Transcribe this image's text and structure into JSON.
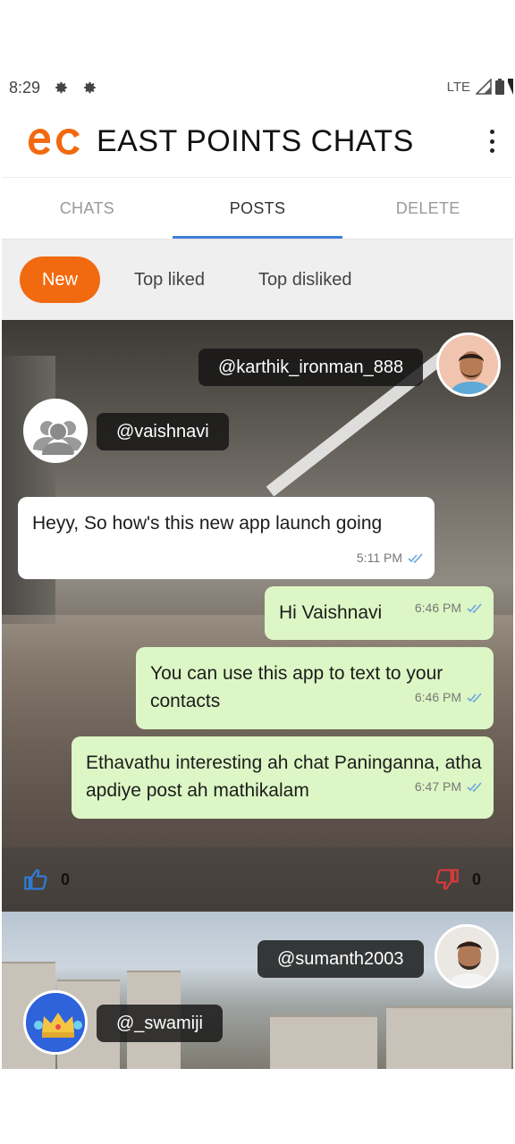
{
  "status_bar": {
    "time": "8:29",
    "network": "LTE"
  },
  "app": {
    "title": "EAST POINTS CHATS",
    "logo_text": "ec",
    "brand_color": "#f26a0f"
  },
  "tabs": [
    {
      "label": "CHATS",
      "active": false
    },
    {
      "label": "POSTS",
      "active": true
    },
    {
      "label": "DELETE",
      "active": false
    }
  ],
  "filters": [
    {
      "label": "New",
      "active": true
    },
    {
      "label": "Top liked",
      "active": false
    },
    {
      "label": "Top disliked",
      "active": false
    }
  ],
  "posts": [
    {
      "sender_handle": "@karthik_ironman_888",
      "receiver_handle": "@vaishnavi",
      "messages": [
        {
          "text": "Heyy, So how's this new app launch going",
          "time": "5:11 PM",
          "side": "in"
        },
        {
          "text": "Hi Vaishnavi",
          "time": "6:46 PM",
          "side": "out"
        },
        {
          "text": "You can use this app to text to your contacts",
          "time": "6:46 PM",
          "side": "out"
        },
        {
          "text": "Ethavathu interesting ah chat Paninganna, atha apdiye post ah mathikalam",
          "time": "6:47 PM",
          "side": "out"
        }
      ],
      "likes": "0",
      "dislikes": "0"
    },
    {
      "sender_handle": "@sumanth2003",
      "receiver_handle": "@_swamiji"
    }
  ]
}
